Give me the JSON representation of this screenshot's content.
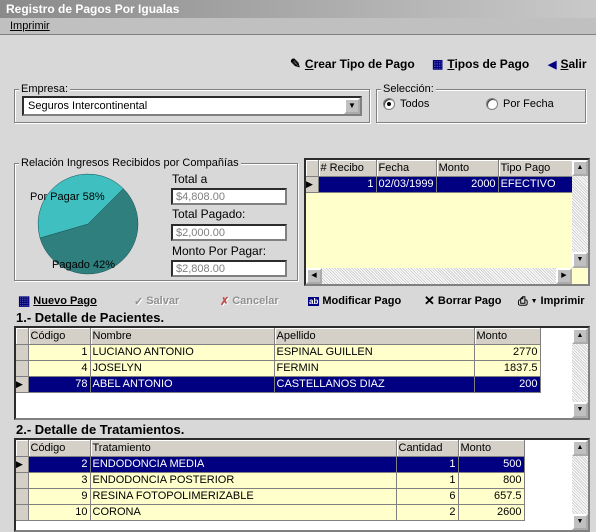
{
  "window": {
    "title": "Registro de Pagos Por Igualas"
  },
  "menu": {
    "items": [
      "Imprimir"
    ]
  },
  "toolbar": {
    "crear_tipo_pago": "Crear Tipo de Pago",
    "tipos_de_pago": "Tipos de Pago",
    "salir": "Salir"
  },
  "empresa": {
    "label": "Empresa:",
    "value": "Seguros Intercontinental"
  },
  "seleccion": {
    "label": "Selección:",
    "options": [
      "Todos",
      "Por Fecha"
    ],
    "selected": "Todos"
  },
  "relacion": {
    "title": "Relación Ingresos Recibidos por Compañías",
    "pie_labels": {
      "por_pagar": "Por Pagar 58%",
      "pagado": "Pagado 42%"
    },
    "total_a_label": "Total a",
    "total_a_value": "$4,808.00",
    "total_pagado_label": "Total Pagado:",
    "total_pagado_value": "$2,000.00",
    "monto_por_pagar_label": "Monto Por Pagar:",
    "monto_por_pagar_value": "$2,808.00"
  },
  "chart_data": {
    "type": "pie",
    "labels": [
      "Por Pagar",
      "Pagado"
    ],
    "values": [
      58,
      42
    ],
    "colors": [
      "#2f7f7f",
      "#3fbfbf"
    ]
  },
  "recibos": {
    "headers": [
      "# Recibo",
      "Fecha",
      "Monto",
      "Tipo Pago"
    ],
    "rows": [
      [
        "1",
        "02/03/1999",
        "2000",
        "EFECTIVO"
      ]
    ]
  },
  "actions": {
    "nuevo_pago": "Nuevo Pago",
    "salvar": "Salvar",
    "cancelar": "Cancelar",
    "modificar_pago": "Modificar Pago",
    "borrar_pago": "Borrar Pago",
    "imprimir": "Imprimir"
  },
  "pacientes": {
    "title": "1.- Detalle de Pacientes.",
    "headers": [
      "Código",
      "Nombre",
      "Apellido",
      "Monto"
    ],
    "rows": [
      [
        "1",
        "LUCIANO ANTONIO",
        "ESPINAL GUILLEN",
        "2770"
      ],
      [
        "4",
        "JOSELYN",
        "FERMIN",
        "1837.5"
      ],
      [
        "78",
        "ABEL ANTONIO",
        "CASTELLANOS DIAZ",
        "200"
      ]
    ]
  },
  "tratamientos": {
    "title": "2.- Detalle de Tratamientos.",
    "headers": [
      "Código",
      "Tratamiento",
      "Cantidad",
      "Monto"
    ],
    "rows": [
      [
        "2",
        "ENDODONCIA MEDIA",
        "1",
        "500"
      ],
      [
        "3",
        "ENDODONCIA POSTERIOR",
        "1",
        "800"
      ],
      [
        "9",
        "RESINA FOTOPOLIMERIZABLE",
        "6",
        "657.5"
      ],
      [
        "10",
        "CORONA",
        "2",
        "2600"
      ]
    ]
  }
}
